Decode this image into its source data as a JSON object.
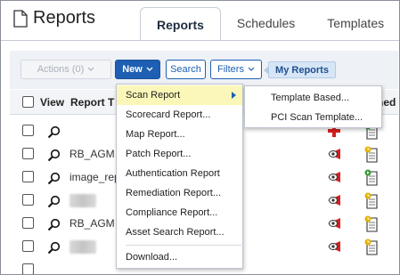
{
  "header": {
    "title": "Reports",
    "page_icon": "document-icon",
    "tabs": [
      {
        "label": "Reports",
        "active": true
      },
      {
        "label": "Schedules",
        "active": false
      },
      {
        "label": "Templates",
        "active": false
      }
    ]
  },
  "toolbar": {
    "actions_label": "Actions (0)",
    "new_label": "New",
    "search_label": "Search",
    "filters_label": "Filters",
    "my_reports_label": "My Reports"
  },
  "table": {
    "columns": {
      "view": "View",
      "report": "Report T",
      "last": "ned"
    },
    "rows": [
      {
        "name": "",
        "status": "red-cross-icon",
        "doc": "document-check-icon"
      },
      {
        "name": "RB_AGM",
        "status": "red-eye-icon",
        "doc": "document-clock-icon"
      },
      {
        "name": "image_rep",
        "status": "red-eye-icon",
        "doc": "document-play-icon"
      },
      {
        "name": "",
        "status": "red-eye-icon",
        "doc": "document-clock-icon"
      },
      {
        "name": "RB_AGM",
        "status": "red-eye-icon",
        "doc": "document-clock-icon"
      },
      {
        "name": "",
        "status": "red-eye-icon",
        "doc": "document-clock-icon"
      },
      {
        "name": "",
        "status": "",
        "doc": ""
      }
    ]
  },
  "new_menu": {
    "items": [
      {
        "label": "Scan Report",
        "has_submenu": true,
        "highlighted": true
      },
      {
        "label": "Scorecard Report..."
      },
      {
        "label": "Map Report..."
      },
      {
        "label": "Patch Report..."
      },
      {
        "label": "Authentication Report"
      },
      {
        "label": "Remediation Report..."
      },
      {
        "label": "Compliance Report..."
      },
      {
        "label": "Asset Search Report..."
      },
      {
        "label": "Download..."
      }
    ]
  },
  "scan_submenu": {
    "items": [
      {
        "label": "Template Based..."
      },
      {
        "label": "PCI Scan Template..."
      }
    ]
  },
  "colors": {
    "primary": "#1e5fb4",
    "highlight": "#fbf7b8",
    "status_red": "#d42020",
    "doc_green": "#3a9a3a",
    "doc_yellow": "#e2b100"
  }
}
